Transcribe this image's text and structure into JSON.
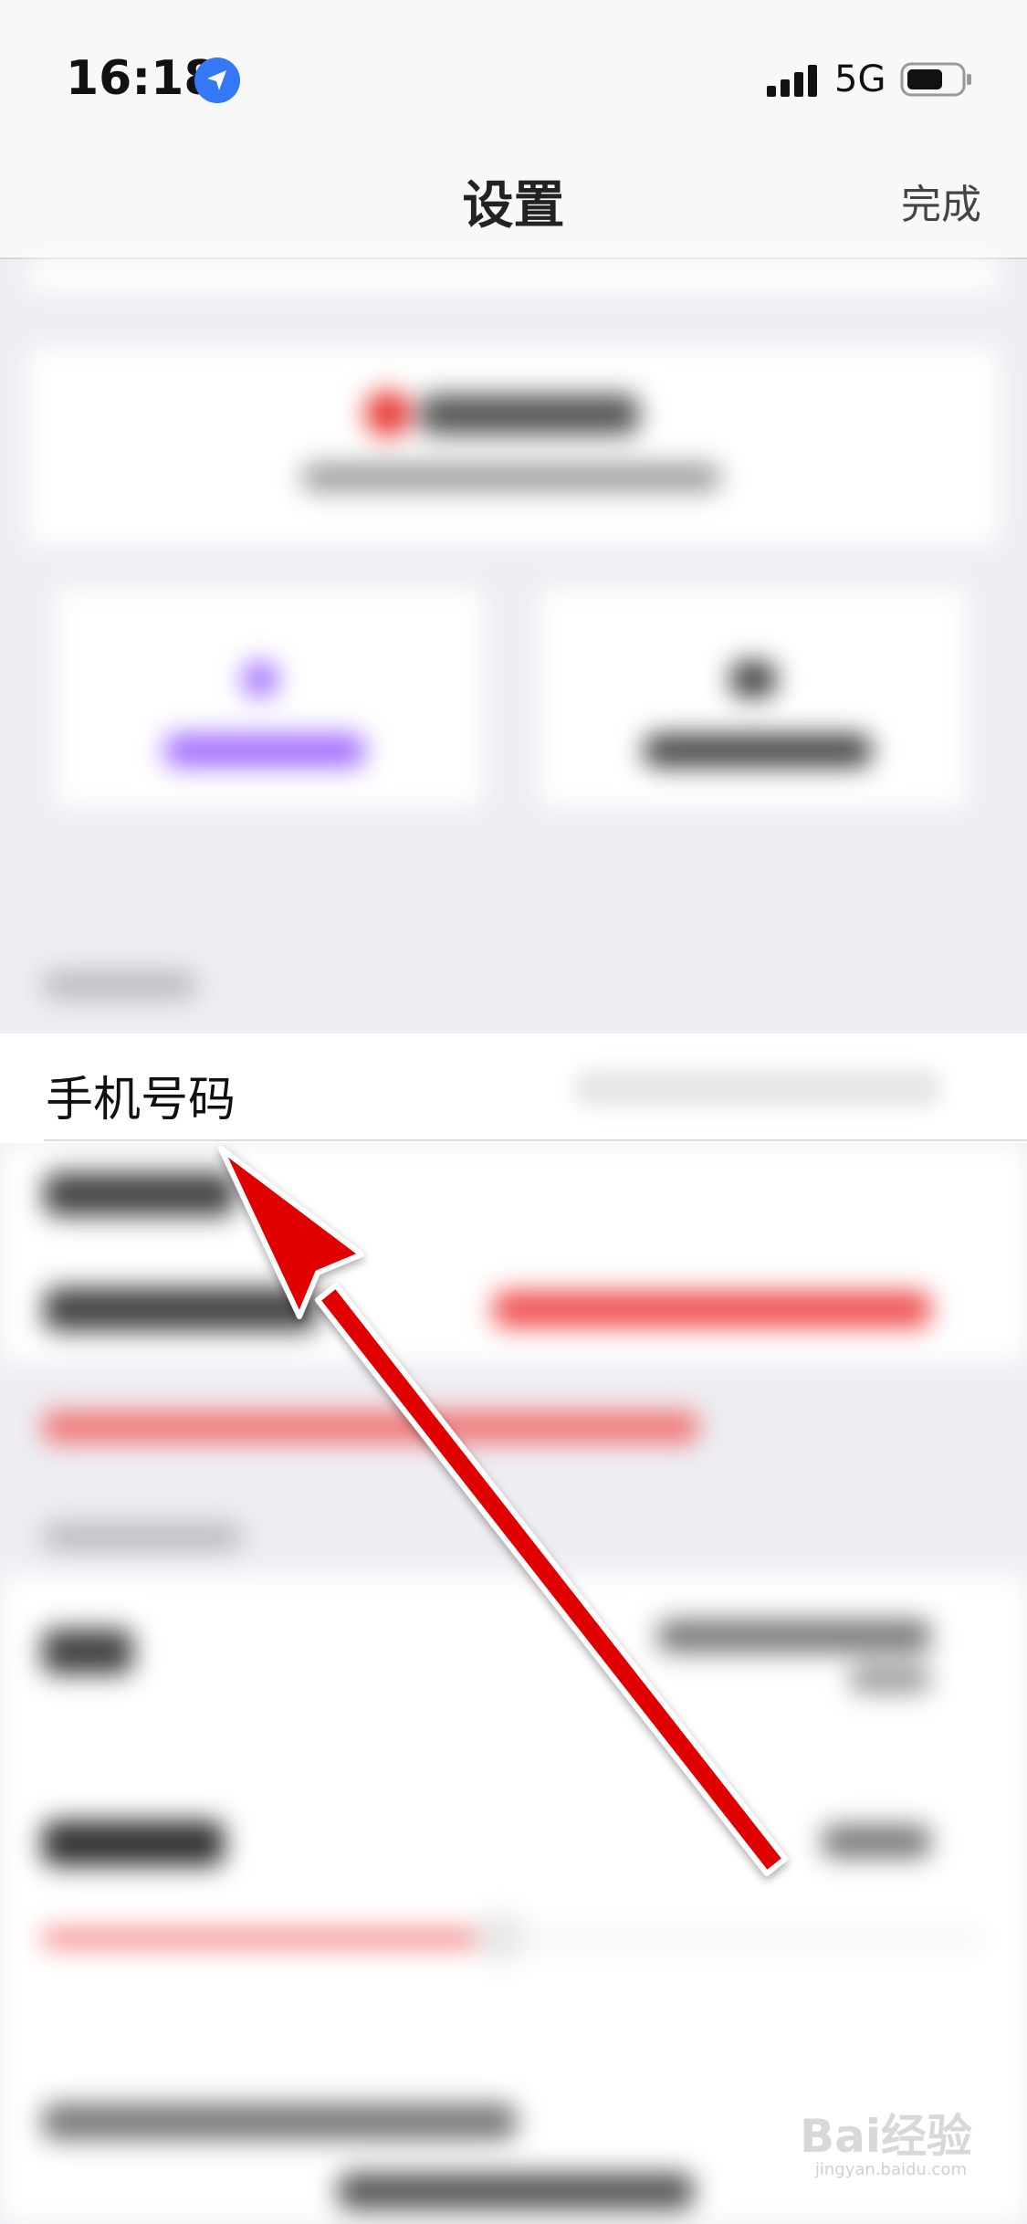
{
  "status_bar": {
    "time": "16:18",
    "network": "5G",
    "location_icon": "location-arrow-icon",
    "signal_icon": "signal-bars-icon",
    "battery_icon": "battery-icon"
  },
  "nav": {
    "title": "设置",
    "done_label": "完成"
  },
  "phone_row": {
    "label": "手机号码"
  },
  "annotation": {
    "arrow_color": "#e00000",
    "arrow_icon": "red-arrow-annotation"
  },
  "watermark": {
    "brand": "Bai经验",
    "url": "jingyan.baidu.com"
  },
  "colors": {
    "accent_blue": "#3478f6",
    "purple": "#a06bff",
    "red": "#e8322e"
  }
}
